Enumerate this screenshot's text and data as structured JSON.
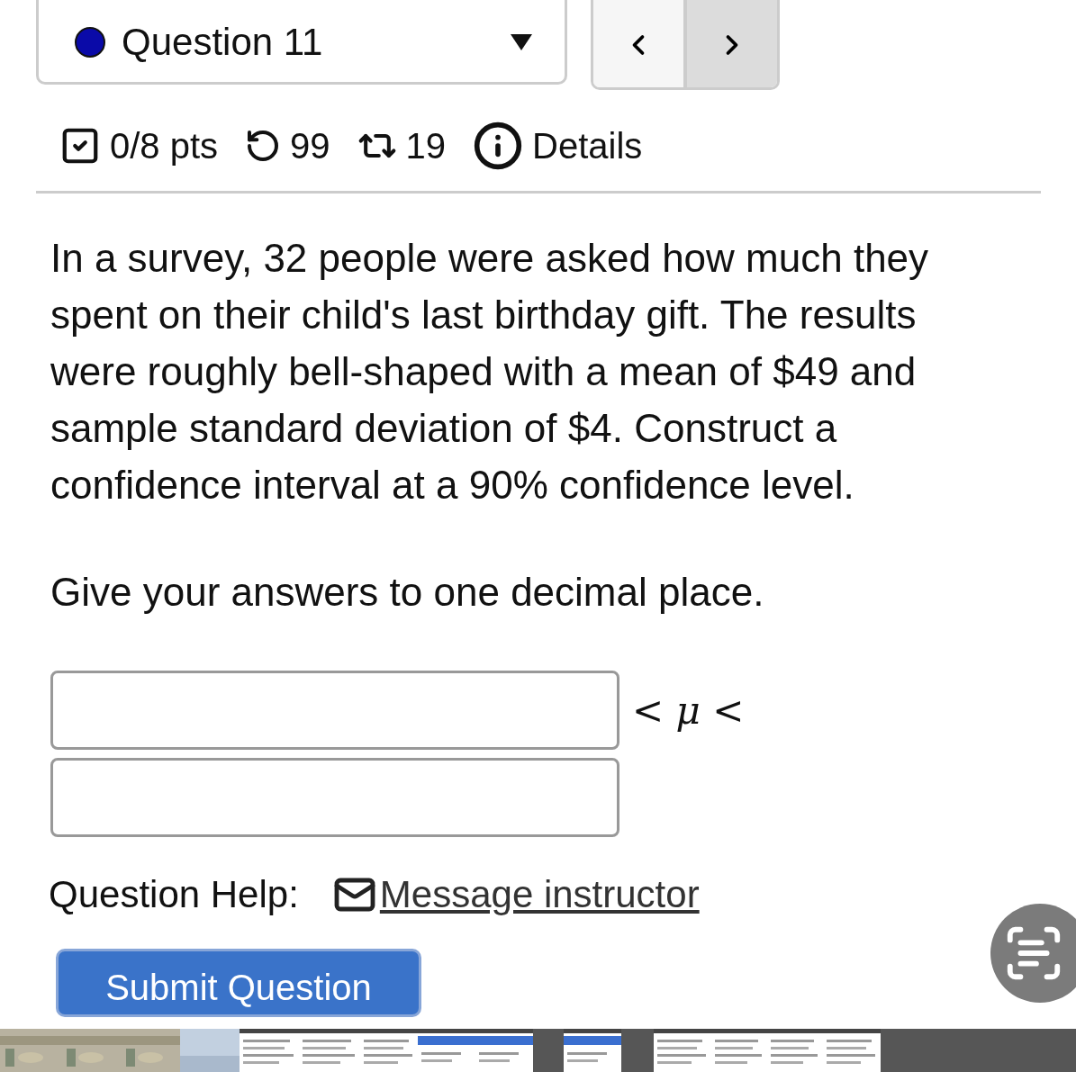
{
  "question_select": {
    "label": "Question 11",
    "current": true
  },
  "meta": {
    "points": "0/8 pts",
    "retries": "99",
    "attempts": "19",
    "details": "Details"
  },
  "question": {
    "paragraphs": [
      "In a survey, 32 people were asked how much they spent on their child's last birthday gift. The results were roughly bell-shaped with a mean of $49 and sample standard deviation of $4. Construct a confidence interval at a 90% confidence level.",
      "Give your answers to one decimal place."
    ]
  },
  "answer": {
    "between_text": "< *μ* <"
  },
  "help": {
    "label": "Question Help:",
    "link": "Message instructor"
  },
  "submit_button": "Submit Question"
}
